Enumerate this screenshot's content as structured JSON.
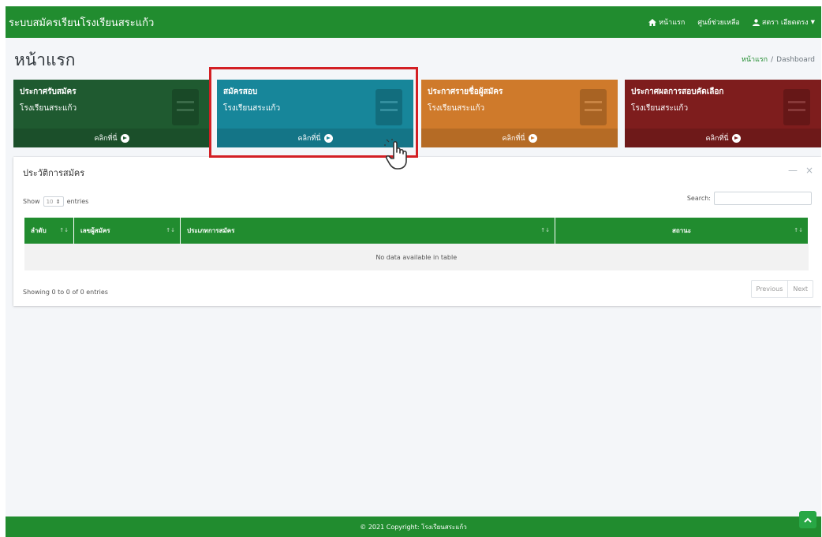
{
  "navbar": {
    "brand": "ระบบสมัครเรียนโรงเรียนสระแก้ว",
    "home_label": "หน้าแรก",
    "help_label": "ศูนย์ช่วยเหลือ",
    "user_label": "สตรา เอียดตรง"
  },
  "header": {
    "title": "หน้าแรก",
    "breadcrumb_home": "หน้าแรก",
    "breadcrumb_sep": "/",
    "breadcrumb_current": "Dashboard"
  },
  "boxes": [
    {
      "title": "ประกาศรับสมัคร",
      "subtitle": "โรงเรียนสระแก้ว",
      "link": "คลิกที่นี่",
      "color": "#1f5a30"
    },
    {
      "title": "สมัครสอบ",
      "subtitle": "โรงเรียนสระแก้ว",
      "link": "คลิกที่นี่",
      "color": "#17869a"
    },
    {
      "title": "ประกาศรายชื่อผู้สมัคร",
      "subtitle": "โรงเรียนสระแก้ว",
      "link": "คลิกที่นี่",
      "color": "#cf7a2b"
    },
    {
      "title": "ประกาศผลการสอบคัดเลือก",
      "subtitle": "โรงเรียนสระแก้ว",
      "link": "คลิกที่นี่",
      "color": "#7e1d1d"
    }
  ],
  "card": {
    "title": "ประวัติการสมัคร",
    "show_label": "Show",
    "entries_value": "10",
    "entries_label": "entries",
    "search_label": "Search:",
    "columns": [
      "ลำดับ",
      "เลขผู้สมัคร",
      "ประเภทการสมัคร",
      "สถานะ"
    ],
    "empty_message": "No data available in table",
    "showing": "Showing 0 to 0 of 0 entries",
    "prev_label": "Previous",
    "next_label": "Next"
  },
  "footer": {
    "copyright": "© 2021 Copyright: โรงเรียนสระแก้ว"
  },
  "colors": {
    "primary": "#218c2f",
    "highlight": "#d31f24"
  }
}
